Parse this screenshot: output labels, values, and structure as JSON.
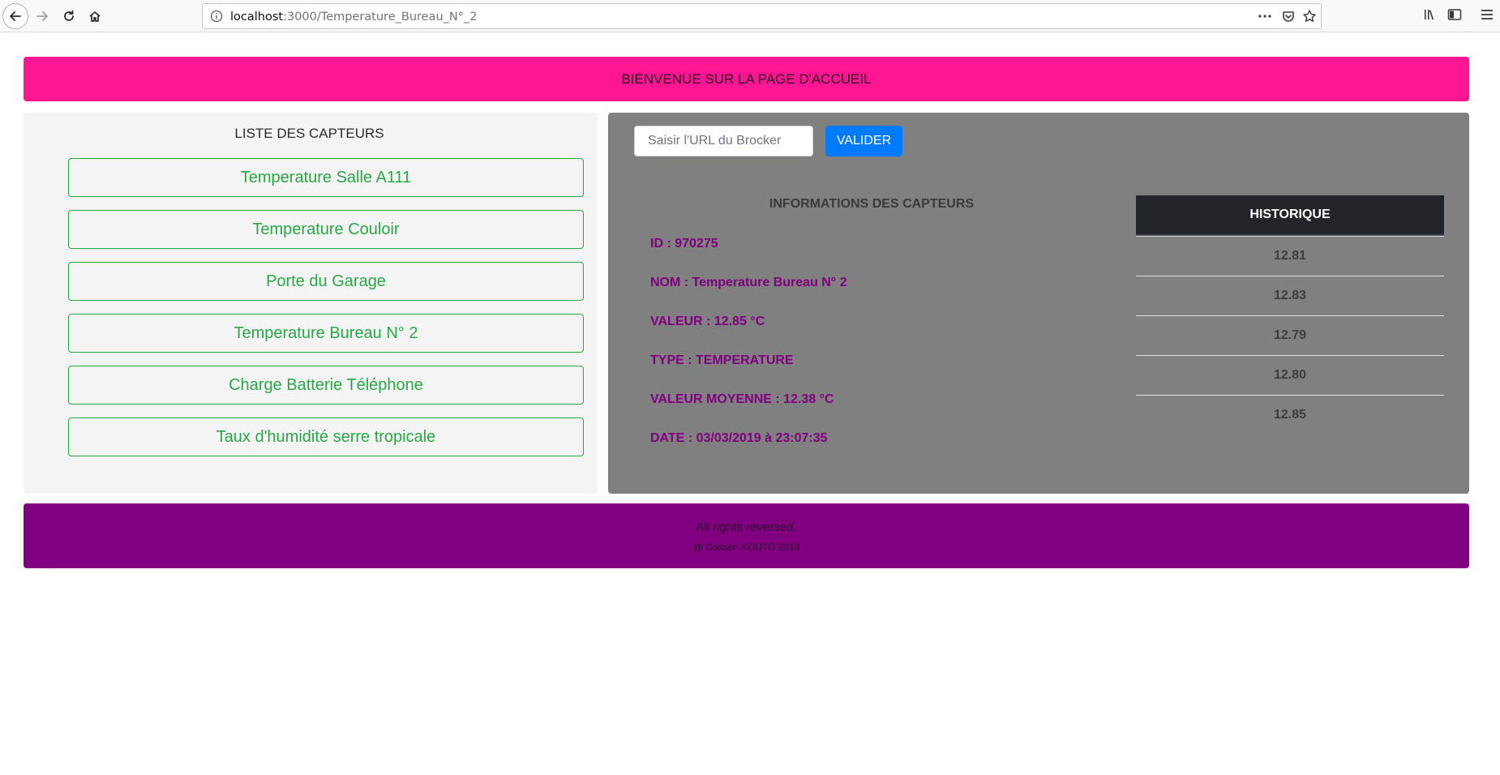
{
  "browser": {
    "url_host": "localhost",
    "url_rest": ":3000/Temperature_Bureau_N°_2",
    "icons": [
      "back-arrow-icon",
      "forward-arrow-icon",
      "reload-icon",
      "home-icon",
      "info-icon",
      "more-icon",
      "pocket-icon",
      "bookmark-star-icon",
      "library-icon",
      "sidebar-icon",
      "menu-icon"
    ]
  },
  "banner": {
    "text": "BIENVENUE SUR LA PAGE D'ACCUEIL",
    "color": "#ff1493"
  },
  "sensors": {
    "title": "LISTE DES CAPTEURS",
    "items": [
      {
        "label": "Temperature Salle A111"
      },
      {
        "label": "Temperature Couloir"
      },
      {
        "label": "Porte du Garage"
      },
      {
        "label": "Temperature Bureau N° 2"
      },
      {
        "label": "Charge Batterie Téléphone"
      },
      {
        "label": "Taux d'humidité serre tropicale"
      }
    ],
    "accent": "#28a745"
  },
  "broker": {
    "placeholder": "Saisir l'URL du Brocker",
    "button_label": "VALIDER",
    "button_color": "#007bff"
  },
  "info": {
    "title": "INFORMATIONS DES CAPTEURS",
    "lines": [
      "ID : 970275",
      "NOM : Temperature Bureau N° 2",
      "VALEUR : 12.85 °C",
      "TYPE : TEMPERATURE",
      "VALEUR MOYENNE : 12.38 °C",
      "DATE : 03/03/2019 à 23:07:35"
    ],
    "color": "#800080"
  },
  "history": {
    "header": "HISTORIQUE",
    "values": [
      "12.81",
      "12.83",
      "12.79",
      "12.80",
      "12.85"
    ]
  },
  "footer": {
    "line1": "All rights reversed.",
    "line2": "@ Dosseh KOUTO 2019",
    "color": "#800080"
  }
}
